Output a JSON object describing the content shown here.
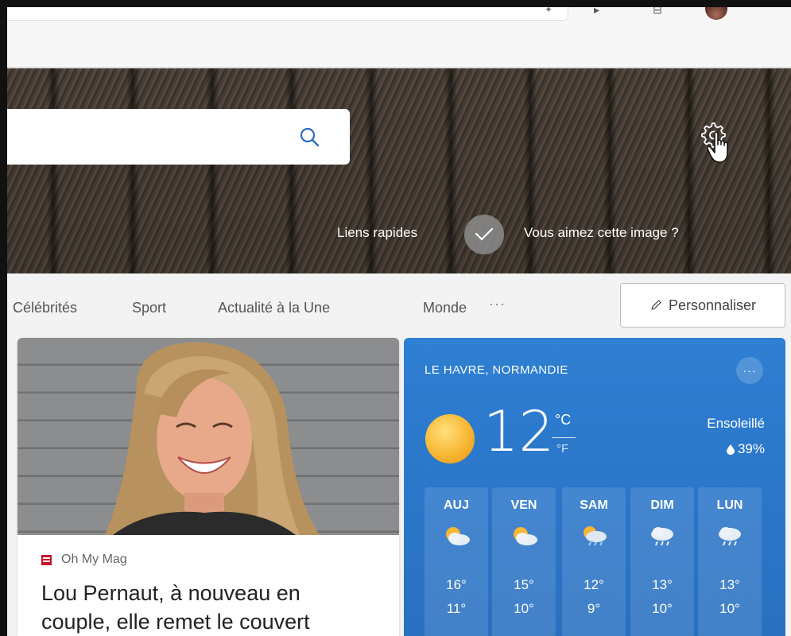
{
  "hero": {
    "quick_links": "Liens rapides",
    "like_prompt": "Vous aimez cette image ?"
  },
  "nav": {
    "items": [
      "Célébrités",
      "Sport",
      "Actualité à la Une",
      "Monde"
    ],
    "more": "···",
    "personalize": "Personnaliser"
  },
  "news": {
    "source": "Oh My Mag",
    "title_line1": "Lou Pernaut, à nouveau en",
    "title_line2": "couple, elle remet le couvert"
  },
  "weather": {
    "location": "LE HAVRE, NORMANDIE",
    "more": "···",
    "temperature": "12",
    "unit_c": "°C",
    "unit_f": "°F",
    "condition": "Ensoleillé",
    "humidity": "39%",
    "forecast": [
      {
        "day": "AUJ",
        "icon": "partly-sunny-icon",
        "high": "16°",
        "low": "11°"
      },
      {
        "day": "VEN",
        "icon": "partly-sunny-icon",
        "high": "15°",
        "low": "10°"
      },
      {
        "day": "SAM",
        "icon": "sun-rain-icon",
        "high": "12°",
        "low": "9°"
      },
      {
        "day": "DIM",
        "icon": "rain-icon",
        "high": "13°",
        "low": "10°"
      },
      {
        "day": "LUN",
        "icon": "rain-icon",
        "high": "13°",
        "low": "10°"
      }
    ]
  },
  "colors": {
    "weather_bg": "#2f7fd2",
    "nav_text": "#555555"
  }
}
